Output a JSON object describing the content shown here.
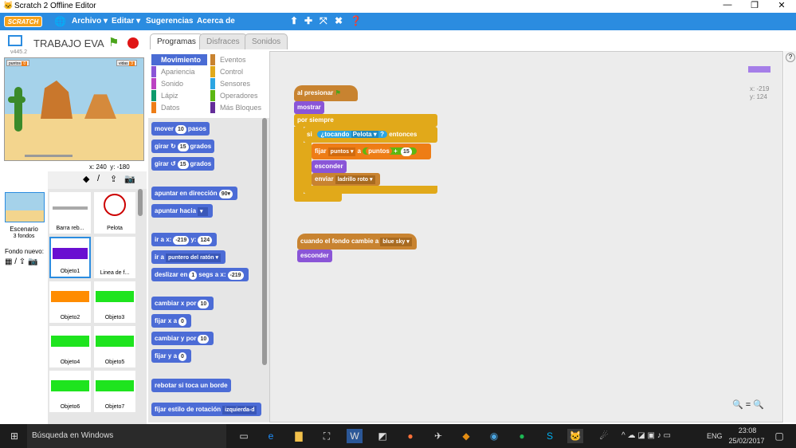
{
  "window": {
    "title": "Scratch 2 Offline Editor"
  },
  "menu": {
    "logo": "SCRATCH",
    "items": [
      "Archivo ▾",
      "Editar ▾",
      "Sugerencias",
      "Acerca de"
    ]
  },
  "project": {
    "name": "TRABAJO EVA",
    "version": "v445.2"
  },
  "stage": {
    "coords_x": "x: 240",
    "coords_y": "y: -180",
    "var1": "puntos",
    "var2": "vidas"
  },
  "tabs": [
    "Programas",
    "Disfraces",
    "Sonidos"
  ],
  "categories": [
    {
      "label": "Movimiento",
      "color": "#4a6cd4"
    },
    {
      "label": "Eventos",
      "color": "#c88330"
    },
    {
      "label": "Apariencia",
      "color": "#8a55d7"
    },
    {
      "label": "Control",
      "color": "#e1a91a"
    },
    {
      "label": "Sonido",
      "color": "#bb42c3"
    },
    {
      "label": "Sensores",
      "color": "#2ca5e2"
    },
    {
      "label": "Lápiz",
      "color": "#0e9a6c"
    },
    {
      "label": "Operadores",
      "color": "#5cb712"
    },
    {
      "label": "Datos",
      "color": "#ee7d16"
    },
    {
      "label": "Más Bloques",
      "color": "#632d99"
    }
  ],
  "palette": {
    "move": "mover",
    "move_n": "10",
    "move_unit": "pasos",
    "turn_r": "girar",
    "turn_r_n": "15",
    "deg": "grados",
    "turn_l": "girar",
    "turn_l_n": "15",
    "point_dir": "apuntar en dirección",
    "point_dir_n": "90▾",
    "point_to": "apuntar hacia",
    "goto_xy": "ir a x:",
    "goto_x": "-219",
    "goto_y_lbl": "y:",
    "goto_y": "124",
    "goto": "ir a",
    "goto_target": "puntero del ratón ▾",
    "glide": "deslizar en",
    "glide_n": "1",
    "glide_mid": "segs a x:",
    "glide_x": "-219",
    "change_x": "cambiar x por",
    "change_x_n": "10",
    "set_x": "fijar x a",
    "set_x_n": "0",
    "change_y": "cambiar y por",
    "change_y_n": "10",
    "set_y": "fijar y a",
    "set_y_n": "0",
    "bounce": "rebotar si toca un borde",
    "rot_style": "fijar estilo de rotación",
    "rot_style_v": "izquierda-d"
  },
  "sprites": {
    "stage_label": "Escenario",
    "stage_sub": "3 fondos",
    "new_bg": "Fondo nuevo:",
    "items": [
      "Barra reb...",
      "Pelota",
      "Objeto1",
      "Linea de f...",
      "Objeto2",
      "Objeto3",
      "Objeto4",
      "Objeto5",
      "Objeto6",
      "Objeto7"
    ]
  },
  "script": {
    "when_flag": "al presionar",
    "show": "mostrar",
    "forever": "por siempre",
    "if": "si",
    "touching": "¿tocando",
    "touching_obj": "Pelota ▾",
    "q": "?",
    "then": "entonces",
    "set": "fijar",
    "set_var": "puntos ▾",
    "to": "a",
    "var_rep": "puntos",
    "plus": "+",
    "plus_n": "15",
    "hide": "esconder",
    "send": "enviar",
    "send_msg": "ladrillo roto ▾",
    "when_bg": "cuando el fondo cambie a",
    "bg_name": "blue sky ▾",
    "hide2": "esconder",
    "sx": "x: -219",
    "sy": "y: 124"
  },
  "taskbar": {
    "search": "Búsqueda en Windows",
    "lang": "ENG",
    "time": "23:08",
    "date": "25/02/2017"
  }
}
